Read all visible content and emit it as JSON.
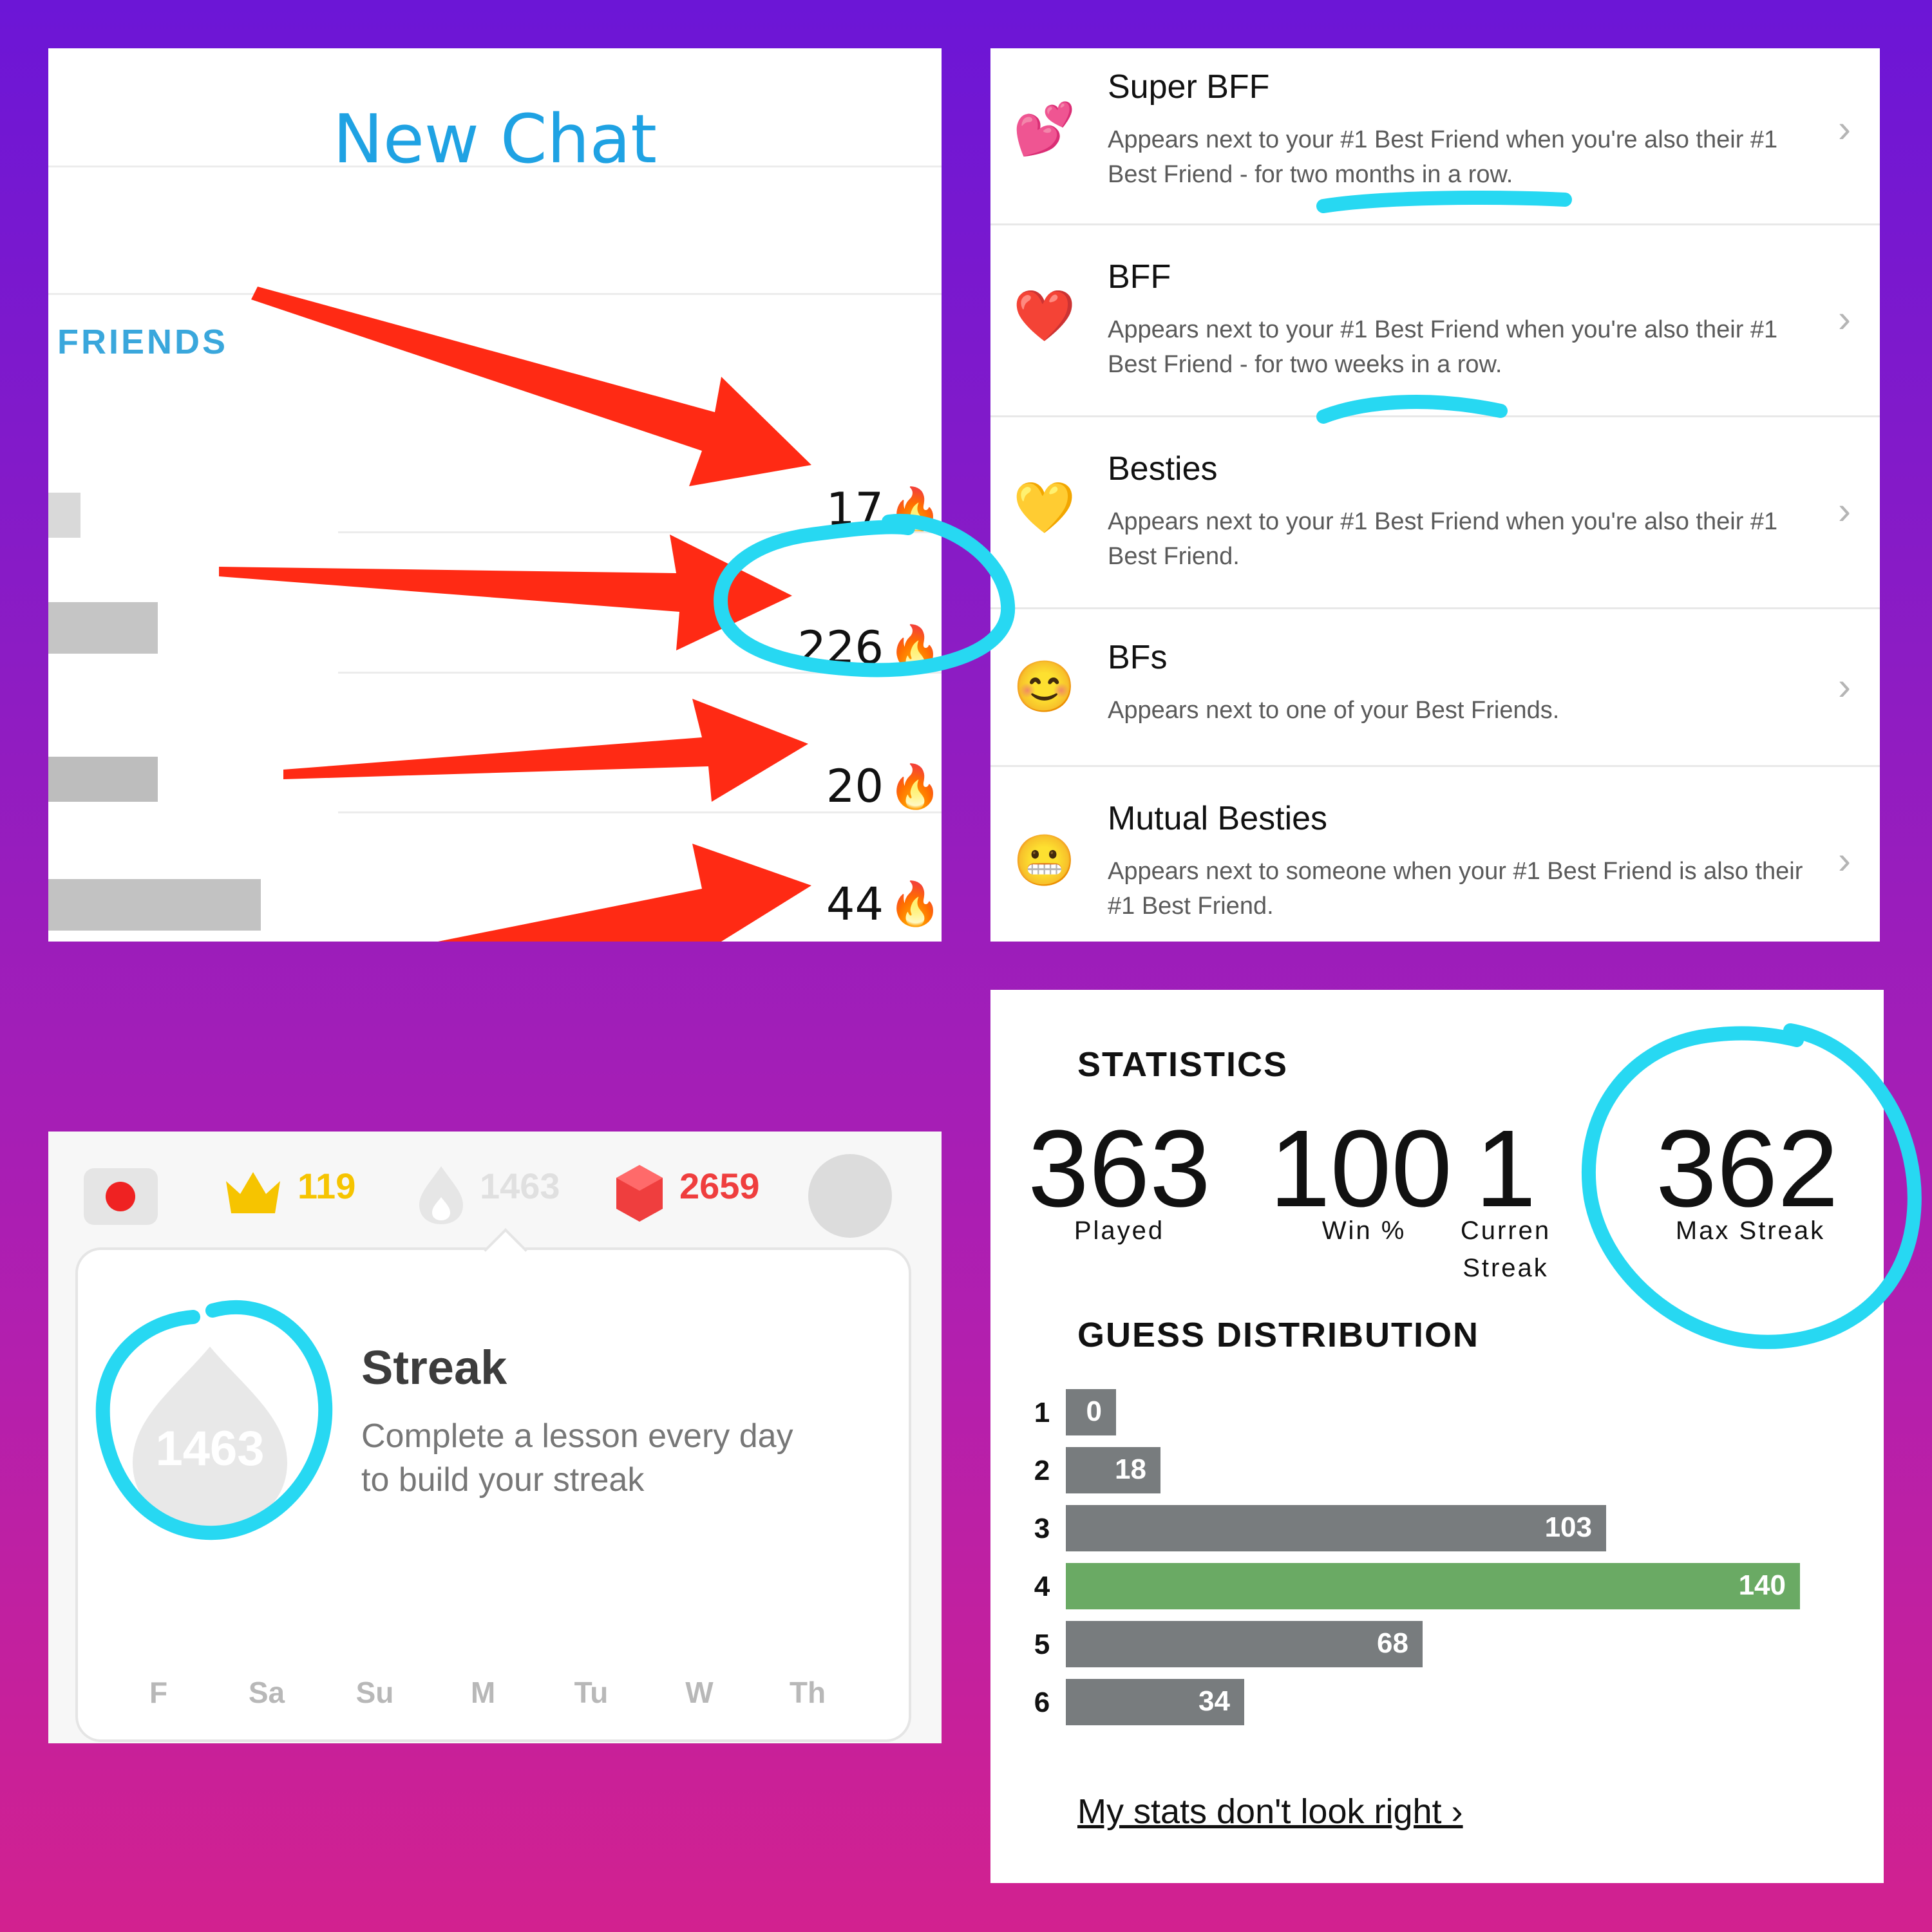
{
  "snapchat": {
    "title": "New Chat",
    "section_header": "FRIENDS",
    "streaks": [
      {
        "count": "17",
        "emoji": "🔥"
      },
      {
        "count": "226",
        "emoji": "🔥"
      },
      {
        "count": "20",
        "emoji": "🔥"
      },
      {
        "count": "44",
        "emoji": "🔥"
      }
    ]
  },
  "friend_emojis": [
    {
      "emoji": "💕",
      "title": "Super BFF",
      "desc": "Appears next to your #1 Best Friend when you're also their #1 Best Friend - for two months in a row."
    },
    {
      "emoji": "❤️",
      "title": "BFF",
      "desc": "Appears next to your #1 Best Friend when you're also their #1 Best Friend - for two weeks in a row."
    },
    {
      "emoji": "💛",
      "title": "Besties",
      "desc": "Appears next to your #1 Best Friend when you're also their #1 Best Friend."
    },
    {
      "emoji": "😊",
      "title": "BFs",
      "desc": "Appears next to one of your Best Friends."
    },
    {
      "emoji": "😬",
      "title": "Mutual Besties",
      "desc": "Appears next to someone when your #1 Best Friend is also their #1 Best Friend."
    }
  ],
  "duolingo": {
    "crowns": "119",
    "streak_top": "1463",
    "gems": "2659",
    "card": {
      "streak_value": "1463",
      "title": "Streak",
      "desc_line1": "Complete a lesson every day",
      "desc_line2": "to build your streak"
    },
    "days": [
      {
        "label": "F",
        "done": true
      },
      {
        "label": "Sa",
        "done": true
      },
      {
        "label": "Su",
        "done": true
      },
      {
        "label": "M",
        "done": true
      },
      {
        "label": "Tu",
        "done": true
      },
      {
        "label": "W",
        "done": true
      },
      {
        "label": "Th",
        "done": false
      }
    ],
    "colors": {
      "flame": "#ff9600",
      "crown": "#f6c400",
      "gem": "#ef3e3e"
    }
  },
  "wordle": {
    "statistics_label": "STATISTICS",
    "stats": [
      {
        "value": "363",
        "label1": "Played",
        "label2": ""
      },
      {
        "value": "100",
        "label1": "Win %",
        "label2": ""
      },
      {
        "value": "1",
        "label1": "Curren",
        "label2": "Streak"
      },
      {
        "value": "362",
        "label1": "Max Streak",
        "label2": ""
      }
    ],
    "distribution_label": "GUESS DISTRIBUTION",
    "link": "My stats don't look right ›"
  },
  "chart_data": {
    "type": "bar",
    "title": "GUESS DISTRIBUTION",
    "categories": [
      "1",
      "2",
      "3",
      "4",
      "5",
      "6"
    ],
    "values": [
      0,
      18,
      103,
      140,
      68,
      34
    ],
    "highlight_index": 3,
    "colors": {
      "bar": "#787c7e",
      "highlight": "#6aaa64"
    }
  },
  "annotation_colors": {
    "circle": "#27d8f2",
    "arrow": "#ff2a14"
  }
}
